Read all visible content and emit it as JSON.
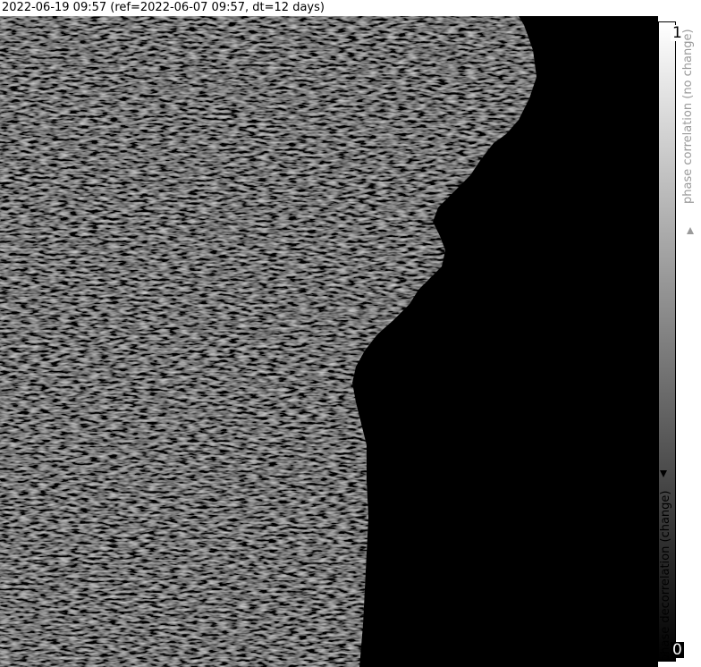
{
  "title": "2022-06-19 09:57 (ref=2022-06-07 09:57, dt=12 days)",
  "colorbar": {
    "max_label": "1",
    "min_label": "0",
    "top_label": "phase correlation (no change)",
    "bottom_label": "phase decorrelation (change)",
    "gradient_top_color": "#ffffff",
    "gradient_bottom_color": "#000000"
  },
  "image": {
    "description_colors": {
      "land_texture": "#3a3a3a",
      "water": "#000000"
    }
  }
}
